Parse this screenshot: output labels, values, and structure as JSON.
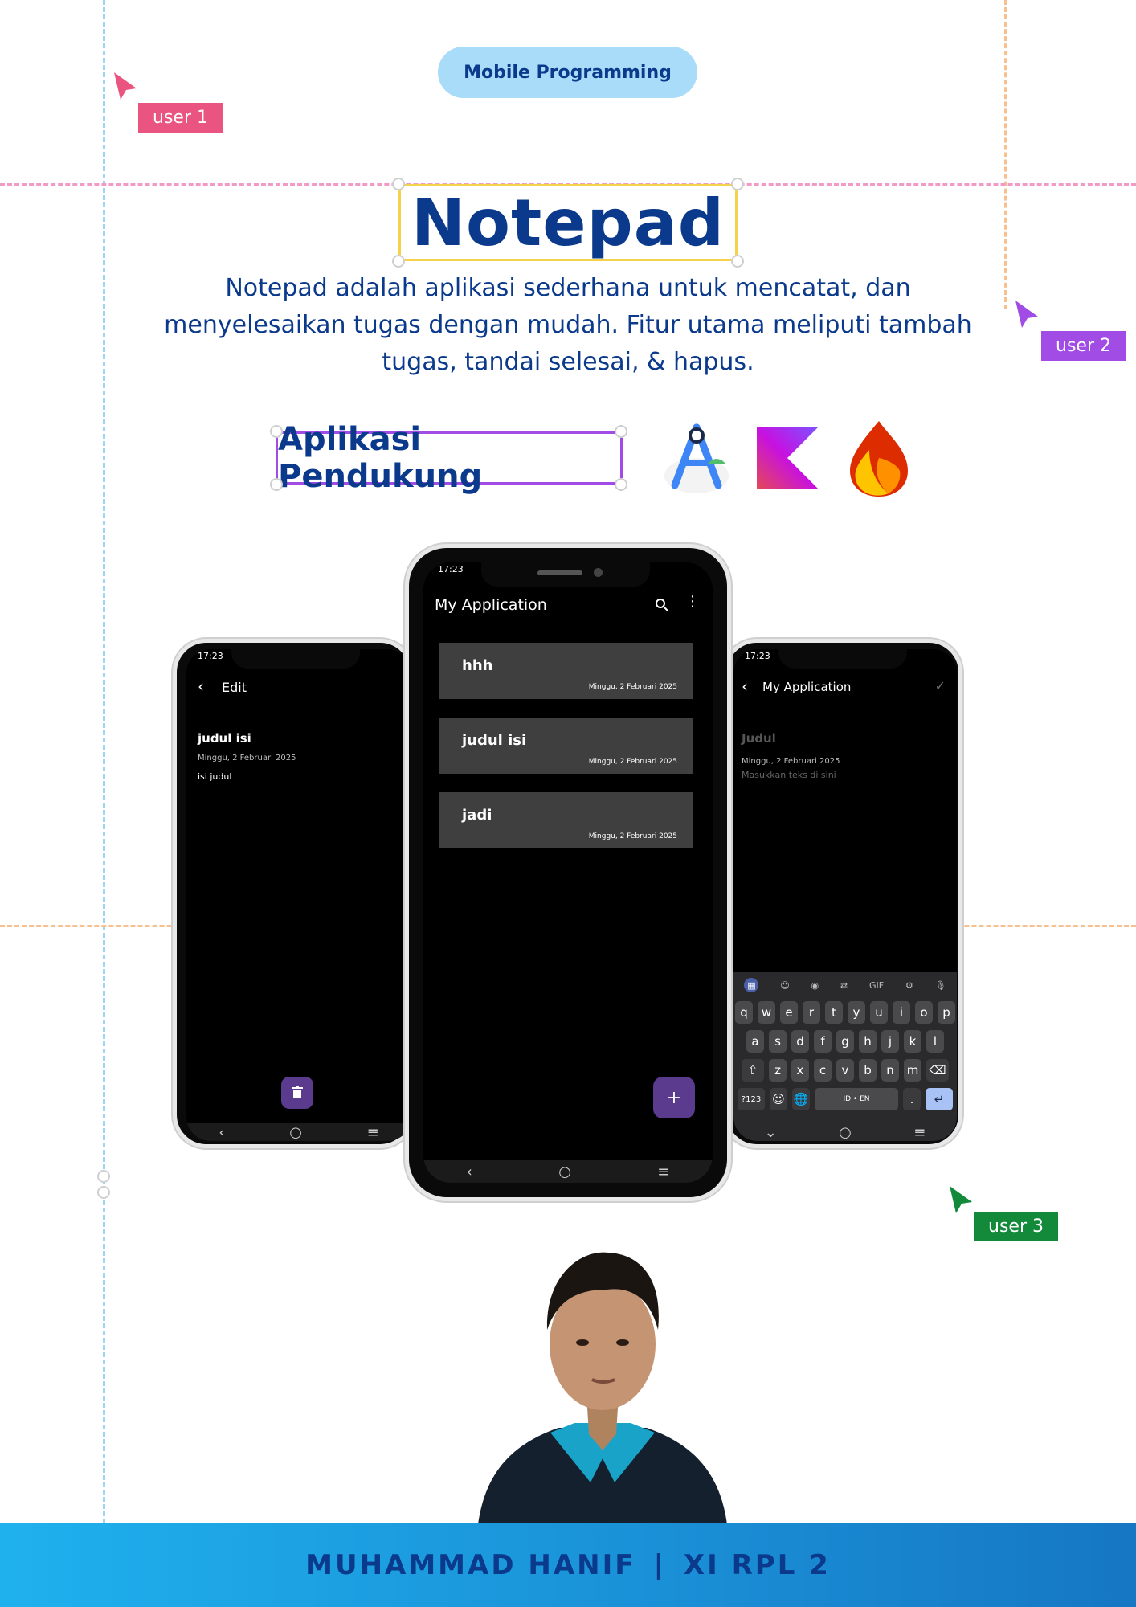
{
  "badge": {
    "label": "Mobile Programming"
  },
  "cursors": [
    {
      "label": "user 1",
      "color": "#ea5480"
    },
    {
      "label": "user 2",
      "color": "#a24ce6"
    },
    {
      "label": "user 3",
      "color": "#128a3a"
    }
  ],
  "title": "Notepad",
  "description": "Notepad adalah aplikasi sederhana untuk mencatat, dan menyelesaikan tugas dengan mudah. Fitur utama meliputi tambah tugas, tandai selesai, & hapus.",
  "support": {
    "heading": "Aplikasi Pendukung",
    "logos": [
      "android-studio-icon",
      "kotlin-icon",
      "firebase-icon"
    ]
  },
  "phone_left": {
    "status_time": "17:23",
    "appbar_title": "Edit",
    "note_title": "judul isi",
    "note_date": "Minggu, 2 Februari 2025",
    "note_body": "isi judul"
  },
  "phone_center": {
    "status_time": "17:23",
    "appbar_title": "My Application",
    "notes": [
      {
        "title": "hhh",
        "date": "Minggu, 2 Februari 2025"
      },
      {
        "title": "judul isi",
        "date": "Minggu, 2 Februari 2025"
      },
      {
        "title": "jadi",
        "date": "Minggu, 2 Februari 2025"
      }
    ],
    "fab": "+"
  },
  "phone_right": {
    "status_time": "17:23",
    "appbar_title": "My Application",
    "title_placeholder": "Judul",
    "date": "Minggu, 2 Februari 2025",
    "body_placeholder": "Masukkan teks di sini",
    "keyboard": {
      "row1": [
        "q",
        "w",
        "e",
        "r",
        "t",
        "y",
        "u",
        "i",
        "o",
        "p"
      ],
      "row2": [
        "a",
        "s",
        "d",
        "f",
        "g",
        "h",
        "j",
        "k",
        "l"
      ],
      "row3": [
        "z",
        "x",
        "c",
        "v",
        "b",
        "n",
        "m"
      ],
      "symbols_key": "?123",
      "space_key": "ID • EN",
      "period_key": "."
    }
  },
  "footer": {
    "name": "MUHAMMAD HANIF",
    "separator": "|",
    "class": "XI RPL 2"
  },
  "colors": {
    "navy": "#0b3a8c",
    "pill": "#a9dcf9",
    "title_frame": "#f4d24a",
    "support_frame": "#a24ce6",
    "fab": "#5b3b8e",
    "footer": "#1a8fd6"
  }
}
